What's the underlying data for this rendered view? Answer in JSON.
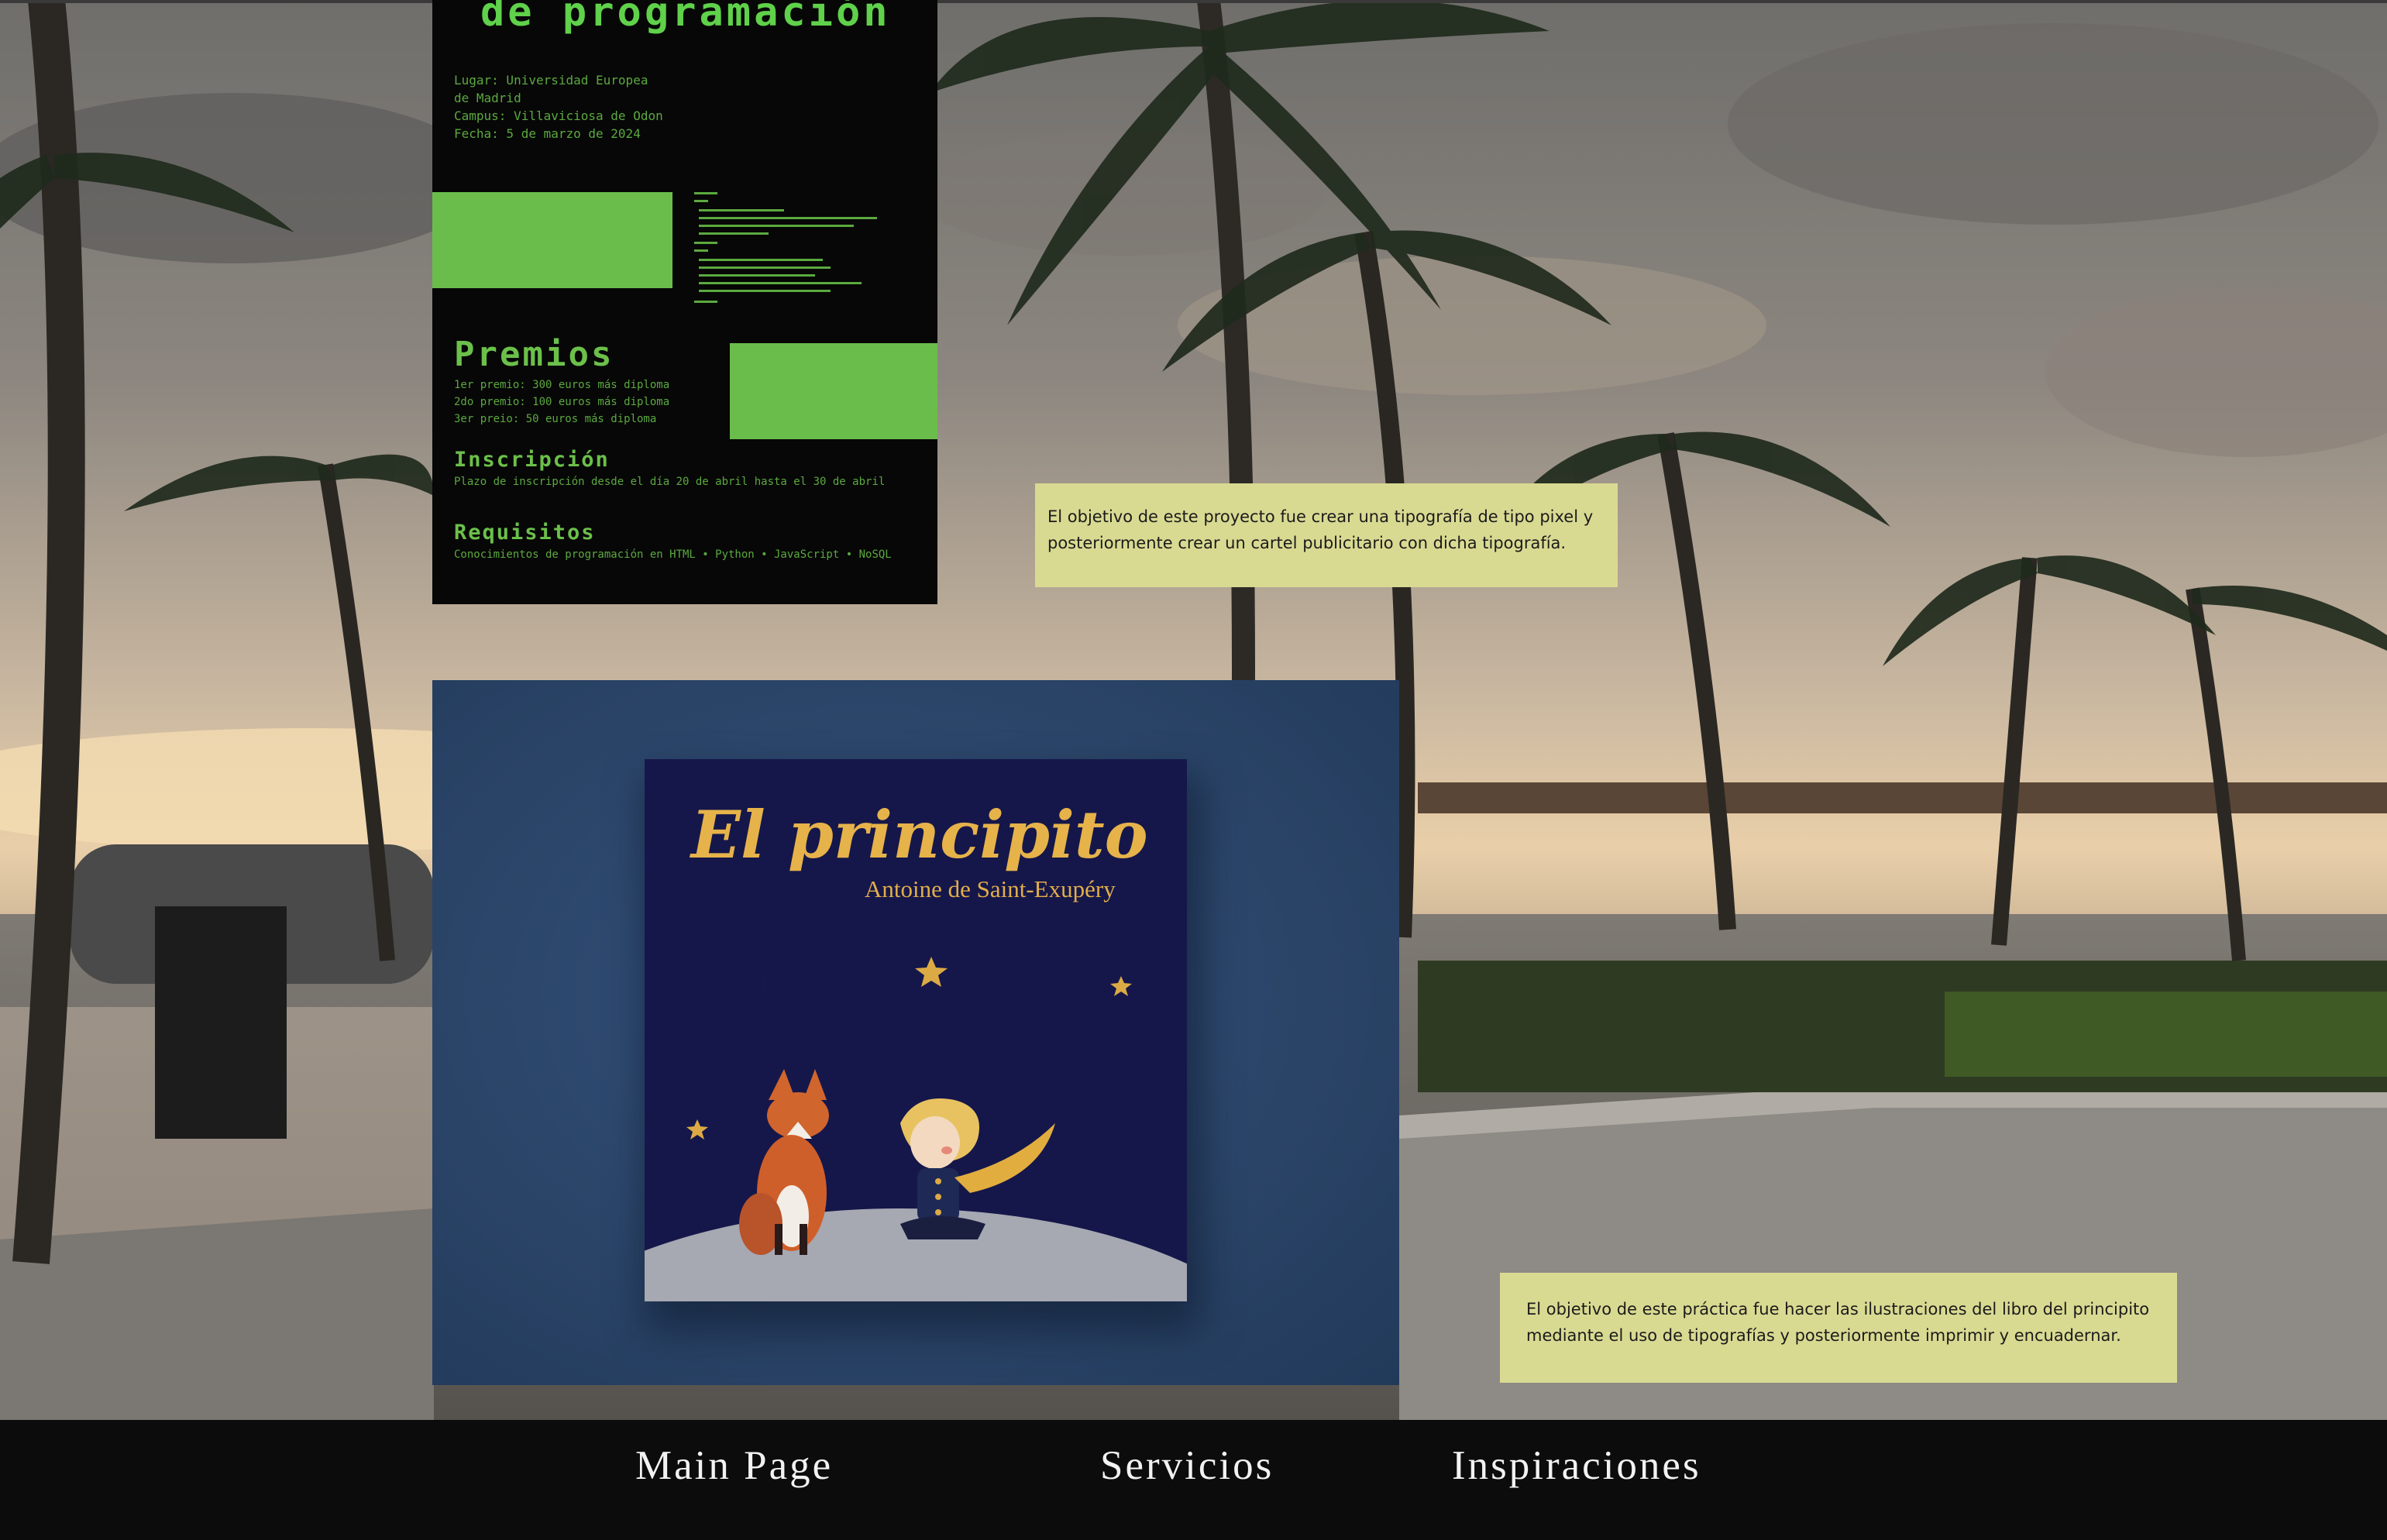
{
  "poster": {
    "title": "de programación",
    "info": [
      "Lugar: Universidad Europea",
      "de Madrid",
      "Campus: Villaviciosa de Odon",
      "Fecha: 5 de marzo de 2024"
    ],
    "premios_heading": "Premios",
    "premios": [
      "1er premio: 300 euros más diploma",
      "2do premio: 100 euros más diploma",
      "3er preio: 50 euros más diploma"
    ],
    "inscripcion_heading": "Inscripción",
    "inscripcion_text": "Plazo de inscripción desde el día 20 de abril hasta el 30 de abril",
    "requisitos_heading": "Requisitos",
    "requisitos_text": "Conocimientos de programación en HTML • Python • JavaScript • NoSQL"
  },
  "captions": {
    "pixel_project": "El objetivo de este proyecto fue crear una tipografía de tipo pixel y posteriormente crear un cartel publicitario con dicha tipografía.",
    "book_project": "El objetivo de este práctica fue hacer las ilustraciones del libro del principito mediante el uso de tipografías y posteriormente imprimir y encuadernar."
  },
  "book": {
    "title": "El principito",
    "author": "Antoine de Saint-Exupéry"
  },
  "nav": {
    "main": "Main Page",
    "servicios": "Servicios",
    "inspiraciones": "Inspiraciones"
  },
  "colors": {
    "pixel_green": "#6abd4b",
    "caption_bg": "#d9da92",
    "book_navy": "#15174a",
    "book_gold": "#e6b24a",
    "footer_bg": "#0c0c0c"
  }
}
